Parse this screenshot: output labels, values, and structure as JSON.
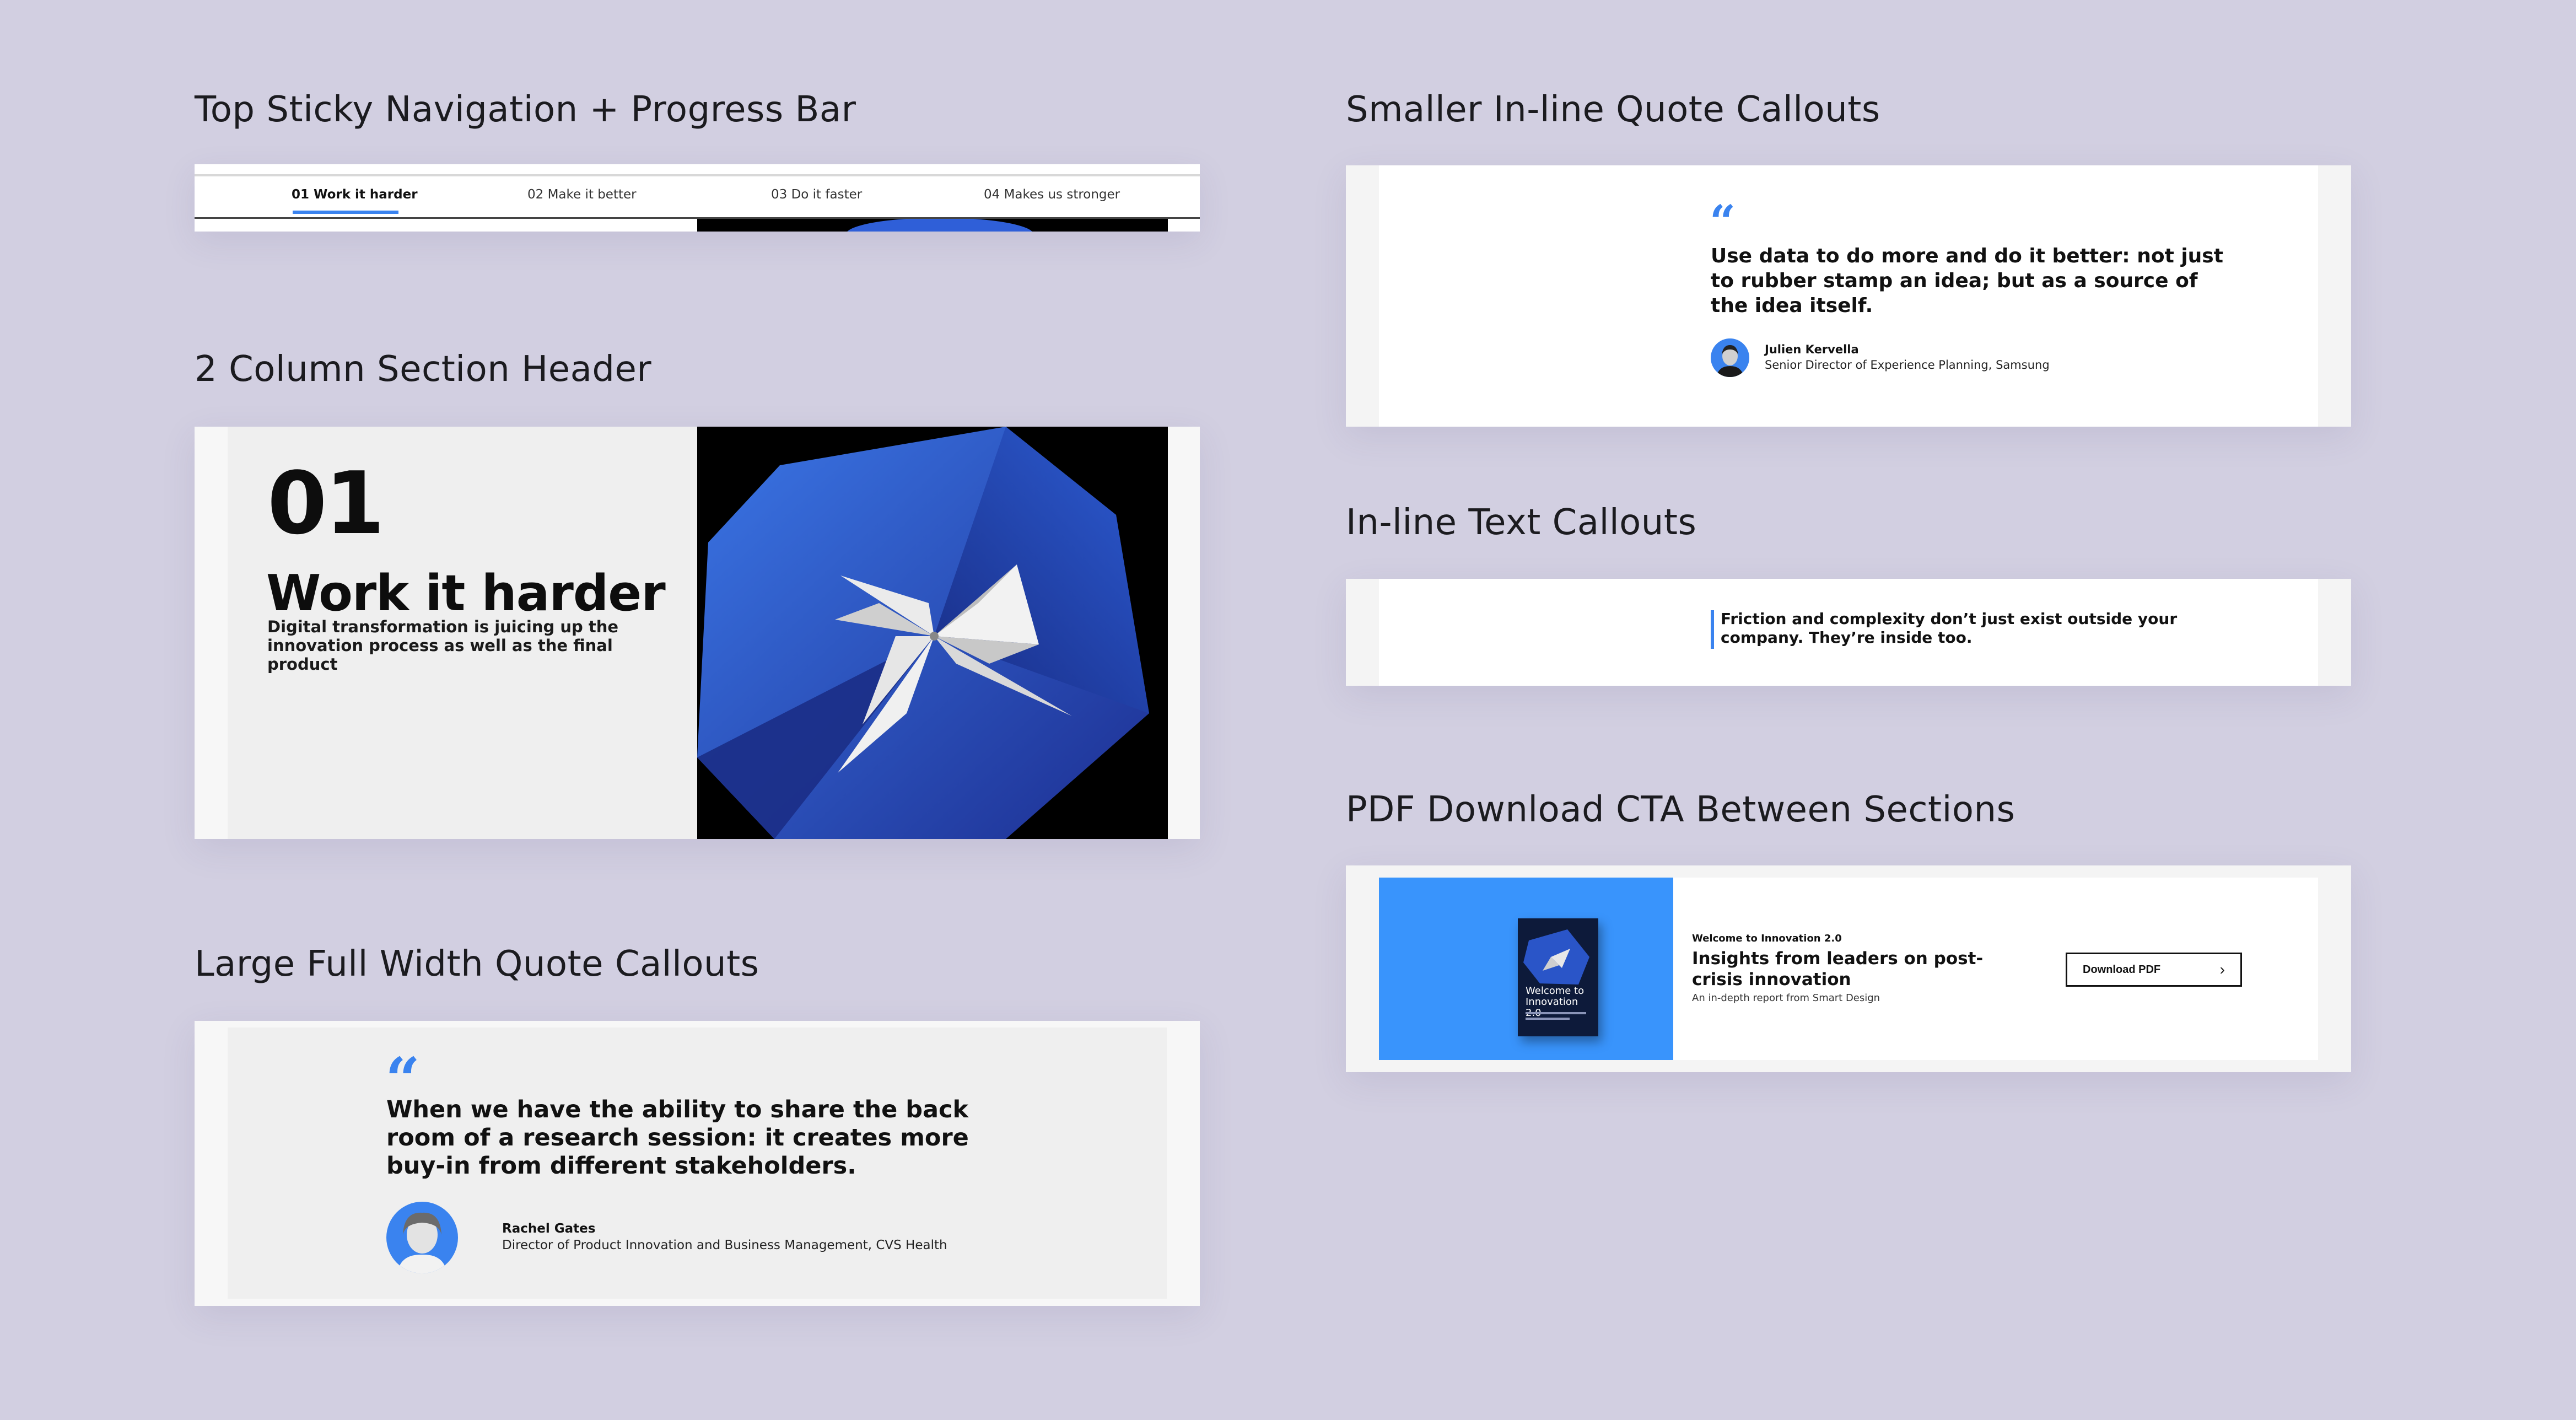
{
  "sections": {
    "nav": "Top Sticky Navigation + Progress Bar",
    "header": "2 Column Section Header",
    "bigquote": "Large Full Width Quote Callouts",
    "smallquote": "Smaller In-line Quote Callouts",
    "textcallout": "In-line Text Callouts",
    "pdf": "PDF Download CTA Between Sections"
  },
  "nav": {
    "items": [
      "01 Work it harder",
      "02 Make it better",
      "03 Do it faster",
      "04 Makes us stronger"
    ],
    "active_index": 0,
    "progress_fraction": 0.25
  },
  "header": {
    "number": "01",
    "title": "Work it harder",
    "description": "Digital transformation is juicing up the innovation process as well as the final product"
  },
  "bigquote": {
    "quote_icon": "quote-icon",
    "text": "When we have the ability to share the back room of a research session: it creates more buy-in from different stakeholders.",
    "name": "Rachel Gates",
    "role": "Director of Product Innovation and Business Management, CVS Health"
  },
  "smallquote": {
    "quote_icon": "quote-icon",
    "text": "Use data to do more and do it better: not just to rubber stamp an idea; but as a source of the idea itself.",
    "name": "Julien Kervella",
    "role": "Senior Director of Experience Planning, Samsung"
  },
  "textcallout": {
    "text": "Friction and complexity don’t just exist outside your company. They’re inside too."
  },
  "pdf": {
    "book_title": "Welcome to Innovation 2.0",
    "eyebrow": "Welcome to Innovation 2.0",
    "title": "Insights from leaders on post-crisis innovation",
    "subtitle": "An in-depth report from Smart Design",
    "button_label": "Download PDF",
    "button_icon": "chevron-right-icon"
  },
  "colors": {
    "background": "#d2cfe1",
    "accent_blue": "#3a83ef",
    "cta_blue": "#3994fc",
    "dark": "#000000"
  }
}
